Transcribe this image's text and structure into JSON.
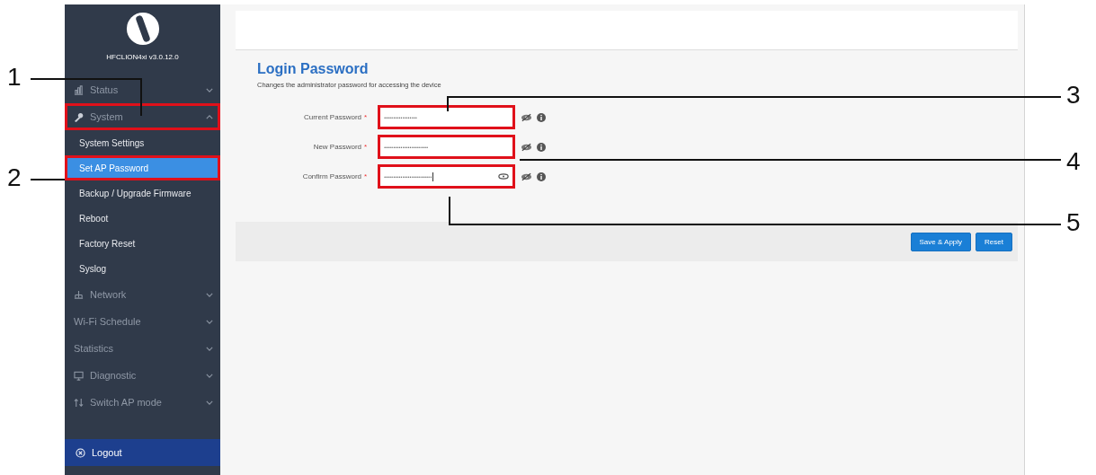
{
  "sidebar": {
    "version": "HFCLION4xi v3.0.12.0",
    "items": [
      {
        "label": "Status",
        "expanded": false,
        "highlighted": false
      },
      {
        "label": "System",
        "expanded": true,
        "highlighted": true,
        "children": [
          {
            "label": "System Settings",
            "selected": false,
            "highlighted": false
          },
          {
            "label": "Set AP Password",
            "selected": true,
            "highlighted": true
          },
          {
            "label": "Backup / Upgrade Firmware",
            "selected": false,
            "highlighted": false
          },
          {
            "label": "Reboot",
            "selected": false,
            "highlighted": false
          },
          {
            "label": "Factory Reset",
            "selected": false,
            "highlighted": false
          },
          {
            "label": "Syslog",
            "selected": false,
            "highlighted": false
          }
        ]
      },
      {
        "label": "Network",
        "expanded": false,
        "highlighted": false
      },
      {
        "label": "Wi-Fi Schedule",
        "expanded": false,
        "highlighted": false
      },
      {
        "label": "Statistics",
        "expanded": false,
        "highlighted": false
      },
      {
        "label": "Diagnostic",
        "expanded": false,
        "highlighted": false
      },
      {
        "label": "Switch AP mode",
        "expanded": false,
        "highlighted": false
      }
    ],
    "logout": "Logout"
  },
  "page": {
    "title": "Login Password",
    "subtitle": "Changes the administrator password for accessing the device"
  },
  "fields": [
    {
      "label": "Current Password",
      "required_mark": "*",
      "value": "••••••••••••••••••",
      "highlighted": true,
      "show_toggle": false,
      "focused": false
    },
    {
      "label": "New Password",
      "required_mark": "*",
      "value": "••••••••••••••••••••••••",
      "highlighted": true,
      "show_toggle": false,
      "focused": false
    },
    {
      "label": "Confirm Password",
      "required_mark": "*",
      "value": "••••••••••••••••••••••••••",
      "highlighted": true,
      "show_toggle": true,
      "focused": true
    }
  ],
  "buttons": [
    "Save & Apply",
    "Reset"
  ],
  "callouts": [
    {
      "label": "1"
    },
    {
      "label": "2"
    },
    {
      "label": "3"
    },
    {
      "label": "4"
    },
    {
      "label": "5"
    }
  ]
}
